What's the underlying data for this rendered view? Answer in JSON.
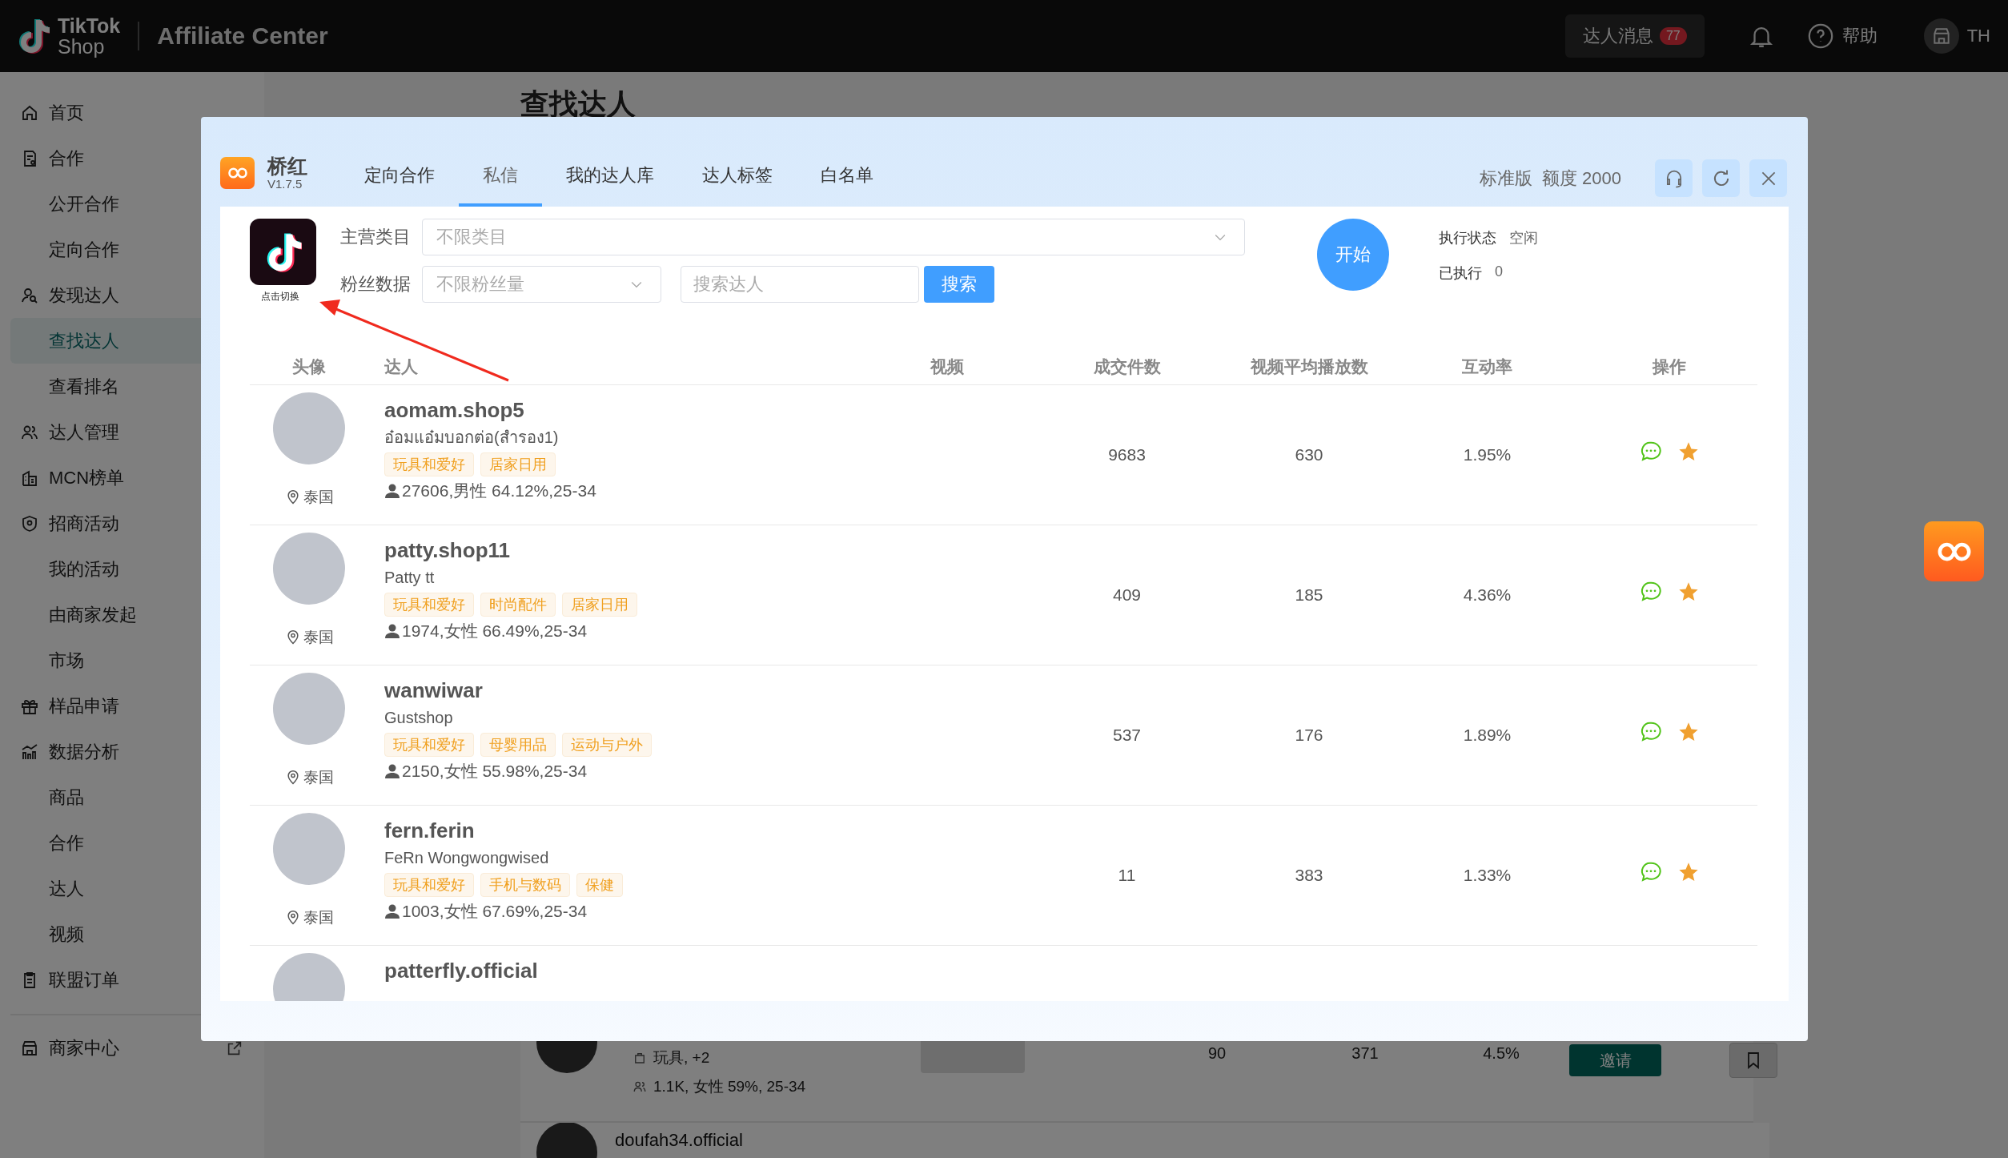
{
  "topbar": {
    "logo_top": "TikTok",
    "logo_bottom": "Shop",
    "title": "Affiliate Center",
    "messages": {
      "label": "达人消息",
      "badge": "77"
    },
    "help": "帮助",
    "user": "TH"
  },
  "sidebar": {
    "items": [
      {
        "label": "首页",
        "kind": "group",
        "selected": false
      },
      {
        "label": "合作",
        "kind": "group",
        "selected": false
      },
      {
        "label": "公开合作",
        "kind": "sub",
        "selected": false
      },
      {
        "label": "定向合作",
        "kind": "sub",
        "selected": false
      },
      {
        "label": "发现达人",
        "kind": "group",
        "selected": false
      },
      {
        "label": "查找达人",
        "kind": "sub",
        "selected": true
      },
      {
        "label": "查看排名",
        "kind": "sub",
        "selected": false
      },
      {
        "label": "达人管理",
        "kind": "group",
        "selected": false
      },
      {
        "label": "MCN榜单",
        "kind": "group",
        "selected": false
      },
      {
        "label": "招商活动",
        "kind": "group",
        "selected": false
      },
      {
        "label": "我的活动",
        "kind": "sub",
        "selected": false
      },
      {
        "label": "由商家发起",
        "kind": "sub",
        "selected": false
      },
      {
        "label": "市场",
        "kind": "sub",
        "selected": false
      },
      {
        "label": "样品申请",
        "kind": "group",
        "selected": false
      },
      {
        "label": "数据分析",
        "kind": "group",
        "selected": false
      },
      {
        "label": "商品",
        "kind": "sub",
        "selected": false
      },
      {
        "label": "合作",
        "kind": "sub",
        "selected": false
      },
      {
        "label": "达人",
        "kind": "sub",
        "selected": false
      },
      {
        "label": "视频",
        "kind": "sub",
        "selected": false
      },
      {
        "label": "联盟订单",
        "kind": "group",
        "selected": false
      }
    ],
    "footer": "商家中心"
  },
  "page": {
    "title": "查找达人",
    "rows": [
      {
        "category": "玩具, +2",
        "audience": "1.1K, 女性 59%, 25-34",
        "column_3": "90",
        "column_4": "371",
        "column_5": "4.5%",
        "button": "邀请"
      },
      {
        "name": "doufah34.official"
      }
    ]
  },
  "modal": {
    "brand": "桥红",
    "version": "V1.7.5",
    "tabs": [
      {
        "label": "定向合作",
        "selected": false
      },
      {
        "label": "私信",
        "selected": true
      },
      {
        "label": "我的达人库",
        "selected": false
      },
      {
        "label": "达人标签",
        "selected": false
      },
      {
        "label": "白名单",
        "selected": false
      }
    ],
    "plan": "标准版",
    "quota": "额度 2000",
    "switch_label": "点击切换",
    "filters": {
      "category_label": "主营类目",
      "category_placeholder": "不限类目",
      "fans_label": "粉丝数据",
      "fans_placeholder": "不限粉丝量",
      "search_placeholder": "搜索达人",
      "search_button": "搜索"
    },
    "start_button": "开始",
    "status": [
      {
        "label": "执行状态",
        "value": "空闲"
      },
      {
        "label": "已执行",
        "value": "0"
      }
    ],
    "table": {
      "columns": [
        "头像",
        "达人",
        "视频",
        "成交件数",
        "视频平均播放数",
        "互动率",
        "操作"
      ],
      "rows": [
        {
          "name": "aomam.shop5",
          "nickname": "อ๋อมแอ๋มบอกต่อ(สำรอง1)",
          "tags": [
            "玩具和爱好",
            "居家日用"
          ],
          "audience": "27606,男性 64.12%,25-34",
          "location": "泰国",
          "sales": "9683",
          "avg_views": "630",
          "engagement": "1.95%"
        },
        {
          "name": "patty.shop11",
          "nickname": "Patty tt",
          "tags": [
            "玩具和爱好",
            "时尚配件",
            "居家日用"
          ],
          "audience": "1974,女性 66.49%,25-34",
          "location": "泰国",
          "sales": "409",
          "avg_views": "185",
          "engagement": "4.36%"
        },
        {
          "name": "wanwiwar",
          "nickname": "Gustshop",
          "tags": [
            "玩具和爱好",
            "母婴用品",
            "运动与户外"
          ],
          "audience": "2150,女性 55.98%,25-34",
          "location": "泰国",
          "sales": "537",
          "avg_views": "176",
          "engagement": "1.89%"
        },
        {
          "name": "fern.ferin",
          "nickname": "FeRn Wongwongwised",
          "tags": [
            "玩具和爱好",
            "手机与数码",
            "保健"
          ],
          "audience": "1003,女性 67.69%,25-34",
          "location": "泰国",
          "sales": "11",
          "avg_views": "383",
          "engagement": "1.33%"
        },
        {
          "name": "patterfly.official"
        }
      ]
    }
  }
}
